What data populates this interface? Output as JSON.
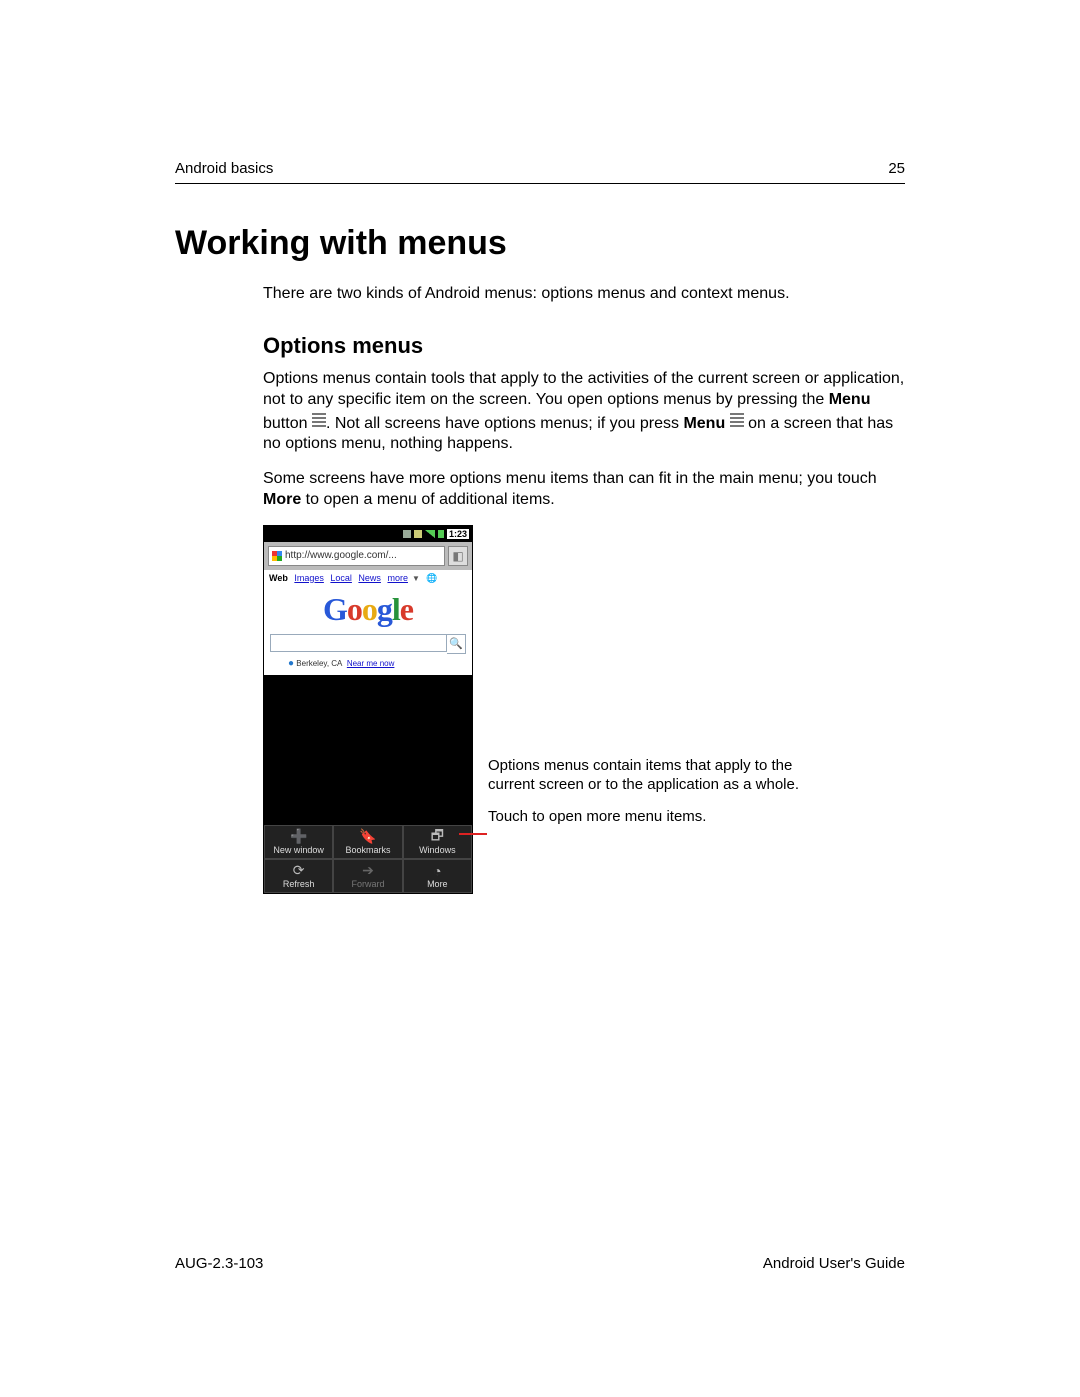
{
  "header": {
    "section": "Android basics",
    "page_num": "25"
  },
  "title": "Working with menus",
  "intro": "There are two kinds of Android menus: options menus and context menus.",
  "section_heading": "Options menus",
  "para1": {
    "a": "Options menus contain tools that apply to the activities of the current screen or application, not to any specific item on the screen. You open options menus by pressing the ",
    "menu_bold1": "Menu",
    "b": " button ",
    "c": ". Not all screens have options menus; if you press ",
    "menu_bold2": "Menu",
    "d": " on a screen that has no options menu, nothing happens."
  },
  "para2": {
    "a": "Some screens have more options menu items than can fit in the main menu; you touch ",
    "more_bold": "More",
    "b": " to open a menu of additional items."
  },
  "screenshot": {
    "status_time": "1:23",
    "url": "http://www.google.com/...",
    "nav": {
      "web": "Web",
      "images": "Images",
      "local": "Local",
      "news": "News",
      "more": "more"
    },
    "logo": {
      "l1": "G",
      "l2": "o",
      "l3": "o",
      "l4": "g",
      "l5": "l",
      "l6": "e"
    },
    "loc_city": "Berkeley, CA",
    "loc_link": "Near me now",
    "options": {
      "new_window": "New window",
      "bookmarks": "Bookmarks",
      "windows": "Windows",
      "refresh": "Refresh",
      "forward": "Forward",
      "more": "More"
    }
  },
  "callout1": "Options menus contain items that apply to the current screen or to the application as a whole.",
  "callout2": "Touch to open more menu items.",
  "footer": {
    "doc_id": "AUG-2.3-103",
    "doc_title": "Android User's Guide"
  }
}
